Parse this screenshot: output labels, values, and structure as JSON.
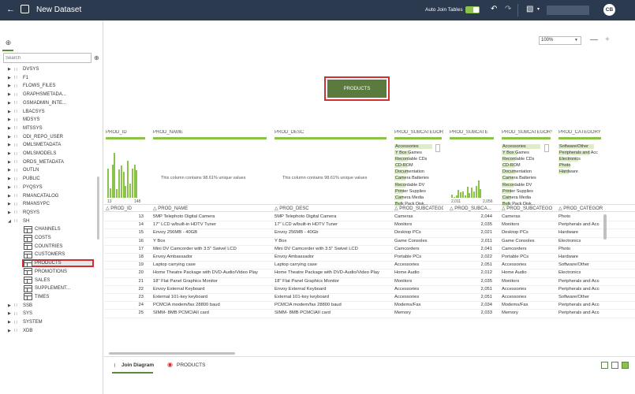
{
  "header": {
    "title": "New Dataset",
    "auto_join_label": "Auto Join Tables",
    "auto_join_on": true,
    "avatar_initials": "CB"
  },
  "sidebar": {
    "search_placeholder": "Search",
    "tree": [
      {
        "label": "DVSYS",
        "type": "schema",
        "expanded": false
      },
      {
        "label": "F1",
        "type": "schema",
        "expanded": false
      },
      {
        "label": "FLOWS_FILES",
        "type": "schema",
        "expanded": false
      },
      {
        "label": "GRAPHSMETADA...",
        "type": "schema",
        "expanded": false
      },
      {
        "label": "GSMADMIN_INTE...",
        "type": "schema",
        "expanded": false
      },
      {
        "label": "LBACSYS",
        "type": "schema",
        "expanded": false
      },
      {
        "label": "MDSYS",
        "type": "schema",
        "expanded": false
      },
      {
        "label": "MTSSYS",
        "type": "schema",
        "expanded": false
      },
      {
        "label": "ODI_REPO_USER",
        "type": "schema",
        "expanded": false
      },
      {
        "label": "OMLSMETADATA",
        "type": "schema",
        "expanded": false
      },
      {
        "label": "OMLSMODELS",
        "type": "schema",
        "expanded": false
      },
      {
        "label": "ORDS_METADATA",
        "type": "schema",
        "expanded": false
      },
      {
        "label": "OUTLN",
        "type": "schema",
        "expanded": false
      },
      {
        "label": "PUBLIC",
        "type": "schema",
        "expanded": false
      },
      {
        "label": "PYQSYS",
        "type": "schema",
        "expanded": false
      },
      {
        "label": "RMANCATALOG",
        "type": "schema",
        "expanded": false
      },
      {
        "label": "RMANSYPC",
        "type": "schema",
        "expanded": false
      },
      {
        "label": "RQSYS",
        "type": "schema",
        "expanded": false
      },
      {
        "label": "SH",
        "type": "schema",
        "expanded": true
      },
      {
        "label": "CHANNELS",
        "type": "table"
      },
      {
        "label": "COSTS",
        "type": "table"
      },
      {
        "label": "COUNTRIES",
        "type": "table"
      },
      {
        "label": "CUSTOMERS",
        "type": "table"
      },
      {
        "label": "PRODUCTS",
        "type": "table",
        "selected": true
      },
      {
        "label": "PROMOTIONS",
        "type": "table"
      },
      {
        "label": "SALES",
        "type": "table"
      },
      {
        "label": "SUPPLEMENT...",
        "type": "table"
      },
      {
        "label": "TIMES",
        "type": "table"
      },
      {
        "label": "SSB",
        "type": "schema",
        "expanded": false
      },
      {
        "label": "SYS",
        "type": "schema",
        "expanded": false
      },
      {
        "label": "SYSTEM",
        "type": "schema",
        "expanded": false
      },
      {
        "label": "XDB",
        "type": "schema",
        "expanded": false
      }
    ]
  },
  "canvas": {
    "zoom": "100%",
    "node_label": "PRODUCTS"
  },
  "profile": {
    "columns": [
      {
        "name": "PROD_ID",
        "kind": "histogram",
        "min": "13",
        "max": "148"
      },
      {
        "name": "PROD_NAME",
        "kind": "unique",
        "text": "This column contains 98.61% unique values"
      },
      {
        "name": "PROD_DESC",
        "kind": "unique",
        "text": "This column contains 98.61% unique values"
      },
      {
        "name": "PROD_SUBCATEGORY",
        "kind": "categories",
        "items": [
          "Accessories",
          "Y Box Games",
          "Recordable CDs",
          "CD-ROM",
          "Documentation",
          "Camera Batteries",
          "Recordable DV",
          "Printer Supplies",
          "Camera Media",
          "Bulk Pack Disk..."
        ],
        "fills": [
          0.85,
          0.35,
          0.3,
          0.28,
          0.3,
          0.25,
          0.25,
          0.2,
          0.2,
          0.15
        ]
      },
      {
        "name": "PROD_SUBCATE",
        "kind": "histogram",
        "min": "2,011",
        "max": "2,056"
      },
      {
        "name": "PROD_SUBCATEGORY_",
        "kind": "categories",
        "items": [
          "Accessories",
          "Y Box Games",
          "Recordable CDs",
          "CD-ROM",
          "Documentation",
          "Camera Batteries",
          "Recordable DV",
          "Printer Supplies",
          "Camera Media",
          "Bulk Pack Disk..."
        ],
        "fills": [
          0.85,
          0.35,
          0.3,
          0.28,
          0.3,
          0.25,
          0.25,
          0.2,
          0.2,
          0.15
        ]
      },
      {
        "name": "PROD_CATEGORY",
        "kind": "categories",
        "items": [
          "Software/Other",
          "Peripherals and Acc",
          "Electronics",
          "Photo",
          "Hardware"
        ],
        "fills": [
          0.9,
          0.8,
          0.5,
          0.3,
          0.25
        ]
      }
    ],
    "hist_prod_id": [
      0.62,
      0.2,
      0.7,
      0.95,
      0.18,
      0.6,
      0.68,
      0.55,
      0.25,
      0.78,
      0.3,
      0.62,
      0.7,
      0.58
    ],
    "hist_subcat_id": [
      0.15,
      0.05,
      0.1,
      0.35,
      0.25,
      0.3,
      0.1,
      0.5,
      0.2,
      0.45,
      0.3,
      0.55,
      0.8,
      0.4
    ]
  },
  "table": {
    "headers": [
      "PROD_ID",
      "PROD_NAME",
      "PROD_DESC",
      "PROD_SUBCATEGORY",
      "PROD_SUBCA...",
      "PROD_SUBCATEGO...",
      "PROD_CATEGORY"
    ],
    "rows": [
      [
        "13",
        "5MP Telephoto Digital Camera",
        "5MP Telephoto Digital Camera",
        "Cameras",
        "2,044",
        "Cameras",
        "Photo"
      ],
      [
        "14",
        "17\" LCD w/built-in HDTV Tuner",
        "17\" LCD w/built-in HDTV Tuner",
        "Monitors",
        "2,035",
        "Monitors",
        "Peripherals and Acce"
      ],
      [
        "15",
        "Envoy 256MB - 40GB",
        "Envoy 256MB - 40Gb",
        "Desktop PCs",
        "2,021",
        "Desktop PCs",
        "Hardware"
      ],
      [
        "16",
        "Y Box",
        "Y Box",
        "Game Consoles",
        "2,011",
        "Game Consoles",
        "Electronics"
      ],
      [
        "17",
        "Mini DV Camcorder with 3.5\" Swivel LCD",
        "Mini DV Camcorder with 3.5\" Swivel LCD",
        "Camcorders",
        "2,041",
        "Camcorders",
        "Photo"
      ],
      [
        "18",
        "Envoy Ambassador",
        "Envoy Ambassador",
        "Portable PCs",
        "2,022",
        "Portable PCs",
        "Hardware"
      ],
      [
        "19",
        "Laptop carrying case",
        "Laptop carrying case",
        "Accessories",
        "2,051",
        "Accessories",
        "Software/Other"
      ],
      [
        "20",
        "Home Theatre Package with DVD-Audio/Video Play",
        "Home Theatre Package with DVD-Audio/Video Play",
        "Home Audio",
        "2,012",
        "Home Audio",
        "Electronics"
      ],
      [
        "21",
        "18\" Flat Panel Graphics Monitor",
        "18\" Flat Panel Graphics Monitor",
        "Monitors",
        "2,035",
        "Monitors",
        "Peripherals and Acce"
      ],
      [
        "22",
        "Envoy External Keyboard",
        "Envoy External Keyboard",
        "Accessories",
        "2,051",
        "Accessories",
        "Peripherals and Acce"
      ],
      [
        "23",
        "External 101-key keyboard",
        "External 101-key keyboard",
        "Accessories",
        "2,051",
        "Accessories",
        "Software/Other"
      ],
      [
        "24",
        "PCMCIA modem/fax 28800 baud",
        "PCMCIA modem/fax 28800 baud",
        "Modems/Fax",
        "2,034",
        "Modems/Fax",
        "Peripherals and Acce"
      ],
      [
        "25",
        "SIMM- 8MB PCMCIAII card",
        "SIMM- 8MB PCMCIAII card",
        "Memory",
        "2,033",
        "Memory",
        "Peripherals and Acce"
      ]
    ]
  },
  "bottom": {
    "join_tab": "Join Diagram",
    "products_tab": "PRODUCTS"
  }
}
